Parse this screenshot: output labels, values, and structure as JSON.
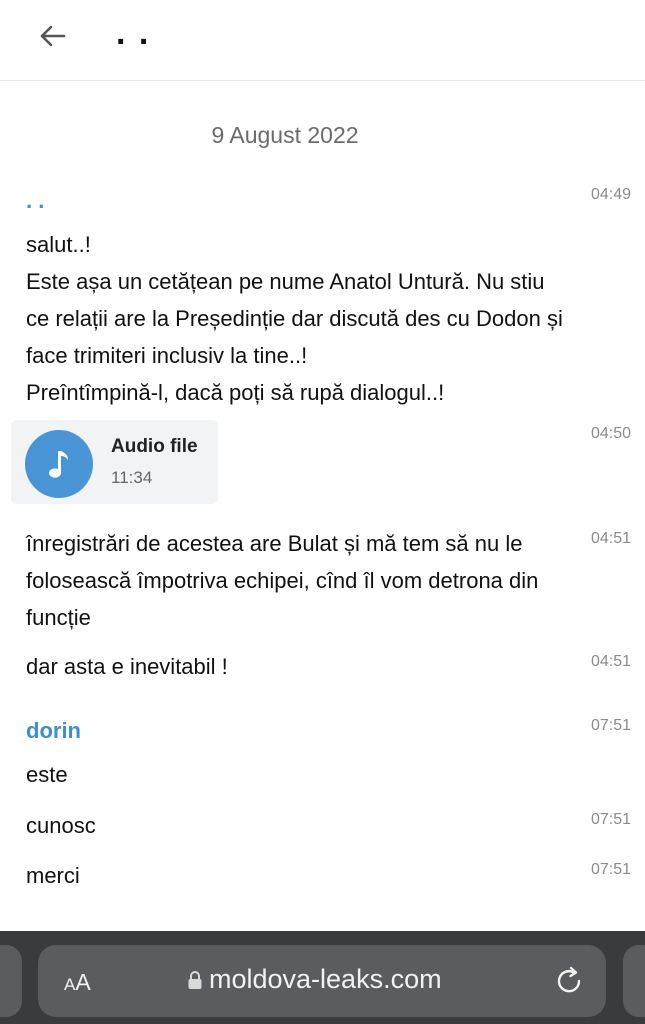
{
  "header": {
    "title": ". ."
  },
  "chat": {
    "date": "9 August 2022",
    "messages": [
      {
        "sender": ". .",
        "time": "04:49",
        "lines": [
          "salut..!",
          "Este așa un cetățean pe nume Anatol Untură. Nu stiu",
          "ce relații are la Președinție dar discută des cu Dodon și",
          "face trimiteri inclusiv la tine..!",
          "Preîntîmpină-l, dacă poți să rupă dialogul..!"
        ]
      },
      {
        "time": "04:50",
        "audio": {
          "title": "Audio file",
          "duration": "11:34"
        }
      },
      {
        "time": "04:51",
        "lines": [
          "înregistrări de acestea are Bulat și mă tem să nu le",
          "folosească împotriva echipei, cînd îl vom detrona din",
          "funcție"
        ]
      },
      {
        "time": "04:51",
        "text": "dar asta e inevitabil !"
      },
      {
        "sender": "dorin",
        "time": "07:51",
        "text": "este"
      },
      {
        "time": "07:51",
        "text": "cunosc"
      },
      {
        "time": "07:51",
        "text": "merci"
      }
    ]
  },
  "browser": {
    "text_size_label_small": "A",
    "text_size_label_large": "A",
    "url": "moldova-leaks.com",
    "icons": [
      "back-arrow-icon",
      "music-note-icon",
      "lock-icon",
      "reload-icon"
    ]
  },
  "colors": {
    "accent": "#3d8fd1",
    "audio_button": "#4a95d6",
    "browser_bar": "#3a3b3d",
    "url_field": "#5b5c5f"
  }
}
